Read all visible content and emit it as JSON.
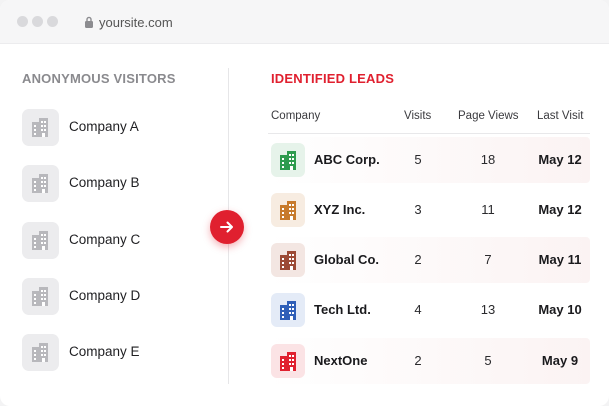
{
  "browser": {
    "url": "yoursite.com"
  },
  "left": {
    "title": "ANONYMOUS VISITORS",
    "visitors": [
      {
        "name": "Company A"
      },
      {
        "name": "Company B"
      },
      {
        "name": "Company C"
      },
      {
        "name": "Company D"
      },
      {
        "name": "Company E"
      }
    ]
  },
  "right": {
    "title": "IDENTIFIED LEADS",
    "columns": {
      "company": "Company",
      "visits": "Visits",
      "page_views": "Page Views",
      "last_visit": "Last Visit"
    },
    "leads": [
      {
        "company": "ABC Corp.",
        "visits": "5",
        "page_views": "18",
        "last_visit": "May 12",
        "color": "#2e9b4e",
        "bg": "#e6f3ea"
      },
      {
        "company": "XYZ Inc.",
        "visits": "3",
        "page_views": "11",
        "last_visit": "May 12",
        "color": "#c77a2c",
        "bg": "#f7ece1"
      },
      {
        "company": "Global Co.",
        "visits": "2",
        "page_views": "7",
        "last_visit": "May 11",
        "color": "#9c4a35",
        "bg": "#f3e6e2"
      },
      {
        "company": "Tech Ltd.",
        "visits": "4",
        "page_views": "13",
        "last_visit": "May 10",
        "color": "#2f5fb8",
        "bg": "#e4ebf7"
      },
      {
        "company": "NextOne",
        "visits": "2",
        "page_views": "5",
        "last_visit": "May 9",
        "color": "#e0202f",
        "bg": "#fbe3e5"
      }
    ]
  },
  "icons": {
    "visitor": "building-icon",
    "transfer": "arrow-right-icon",
    "lock": "lock-icon"
  },
  "colors": {
    "accent": "#e0202f",
    "muted_icon": "#b8b8bc"
  }
}
